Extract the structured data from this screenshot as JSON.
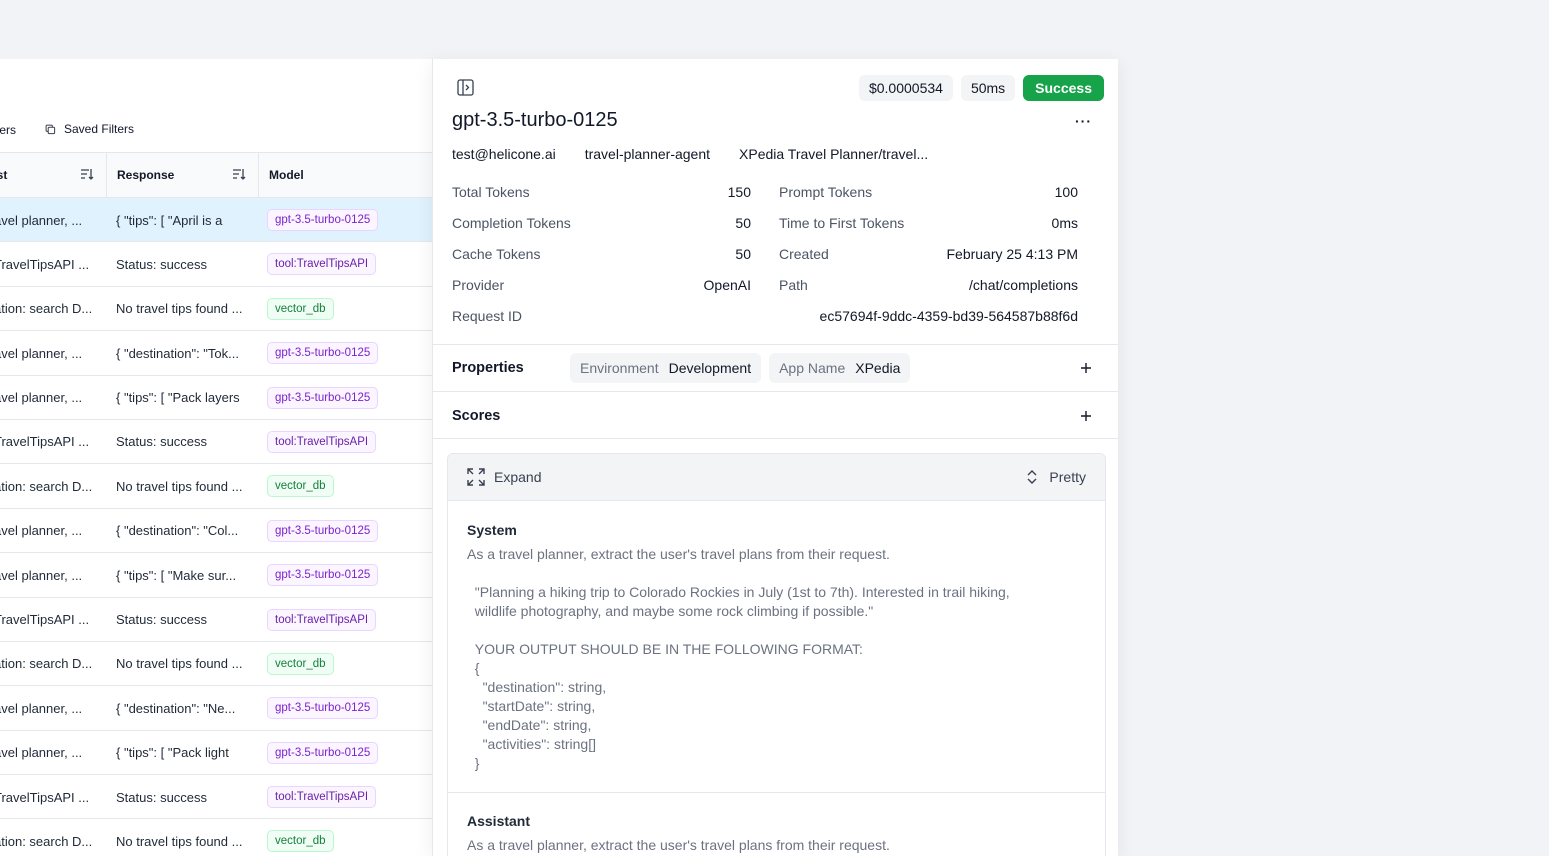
{
  "filters": {
    "filters_label": "ters",
    "saved_filters_label": "Saved Filters"
  },
  "table": {
    "columns": [
      "est",
      "Response",
      "Model"
    ],
    "rows": [
      {
        "request": "avel planner, ...",
        "response": "{ \"tips\": [ \"April is a",
        "model": "gpt-3.5-turbo-0125",
        "kind": "gpt",
        "selected": true
      },
      {
        "request": "TravelTipsAPI ...",
        "response": "Status: success",
        "model": "tool:TravelTipsAPI",
        "kind": "tool"
      },
      {
        "request": "ation: search D...",
        "response": "No travel tips found ...",
        "model": "vector_db",
        "kind": "vector"
      },
      {
        "request": "avel planner, ...",
        "response": "{ \"destination\": \"Tok...",
        "model": "gpt-3.5-turbo-0125",
        "kind": "gpt"
      },
      {
        "request": "avel planner, ...",
        "response": "{ \"tips\": [ \"Pack layers",
        "model": "gpt-3.5-turbo-0125",
        "kind": "gpt"
      },
      {
        "request": "TravelTipsAPI ...",
        "response": "Status: success",
        "model": "tool:TravelTipsAPI",
        "kind": "tool"
      },
      {
        "request": "ation: search D...",
        "response": "No travel tips found ...",
        "model": "vector_db",
        "kind": "vector"
      },
      {
        "request": "avel planner, ...",
        "response": "{ \"destination\": \"Col...",
        "model": "gpt-3.5-turbo-0125",
        "kind": "gpt"
      },
      {
        "request": "avel planner, ...",
        "response": "{ \"tips\": [ \"Make sur...",
        "model": "gpt-3.5-turbo-0125",
        "kind": "gpt"
      },
      {
        "request": "TravelTipsAPI ...",
        "response": "Status: success",
        "model": "tool:TravelTipsAPI",
        "kind": "tool"
      },
      {
        "request": "ation: search D...",
        "response": "No travel tips found ...",
        "model": "vector_db",
        "kind": "vector"
      },
      {
        "request": "avel planner, ...",
        "response": "{ \"destination\": \"Ne...",
        "model": "gpt-3.5-turbo-0125",
        "kind": "gpt"
      },
      {
        "request": "avel planner, ...",
        "response": "{ \"tips\": [ \"Pack light",
        "model": "gpt-3.5-turbo-0125",
        "kind": "gpt"
      },
      {
        "request": "TravelTipsAPI ...",
        "response": "Status: success",
        "model": "tool:TravelTipsAPI",
        "kind": "tool"
      },
      {
        "request": "ation: search D...",
        "response": "No travel tips found ...",
        "model": "vector_db",
        "kind": "vector"
      }
    ]
  },
  "detail": {
    "cost": "$0.0000534",
    "latency": "50ms",
    "status": "Success",
    "model": "gpt-3.5-turbo-0125",
    "more_label": "···",
    "user": "test@helicone.ai",
    "agent": "travel-planner-agent",
    "path_label": "XPedia Travel Planner/travel...",
    "stats_left": [
      {
        "label": "Total Tokens",
        "value": "150"
      },
      {
        "label": "Completion Tokens",
        "value": "50"
      },
      {
        "label": "Cache Tokens",
        "value": "50"
      },
      {
        "label": "Provider",
        "value": "OpenAI"
      },
      {
        "label": "Request ID",
        "value": ""
      }
    ],
    "stats_right": [
      {
        "label": "Prompt Tokens",
        "value": "100"
      },
      {
        "label": "Time to First Tokens",
        "value": "0ms"
      },
      {
        "label": "Created",
        "value": "February 25 4:13 PM"
      },
      {
        "label": "Path",
        "value": "/chat/completions"
      },
      {
        "label": "",
        "value": "ec57694f-9ddc-4359-bd39-564587b88f6d"
      }
    ],
    "properties_label": "Properties",
    "properties": [
      {
        "key": "Environment",
        "value": "Development"
      },
      {
        "key": "App Name",
        "value": "XPedia"
      }
    ],
    "scores_label": "Scores",
    "expand_label": "Expand",
    "pretty_label": "Pretty",
    "messages": [
      {
        "role": "System",
        "content": "As a travel planner, extract the user's travel plans from their request.\n\n  \"Planning a hiking trip to Colorado Rockies in July (1st to 7th). Interested in trail hiking,\n  wildlife photography, and maybe some rock climbing if possible.\"\n\n  YOUR OUTPUT SHOULD BE IN THE FOLLOWING FORMAT:\n  {\n    \"destination\": string,\n    \"startDate\": string,\n    \"endDate\": string,\n    \"activities\": string[]\n  }"
      },
      {
        "role": "Assistant",
        "content": "As a travel planner, extract the user's travel plans from their request."
      }
    ]
  }
}
